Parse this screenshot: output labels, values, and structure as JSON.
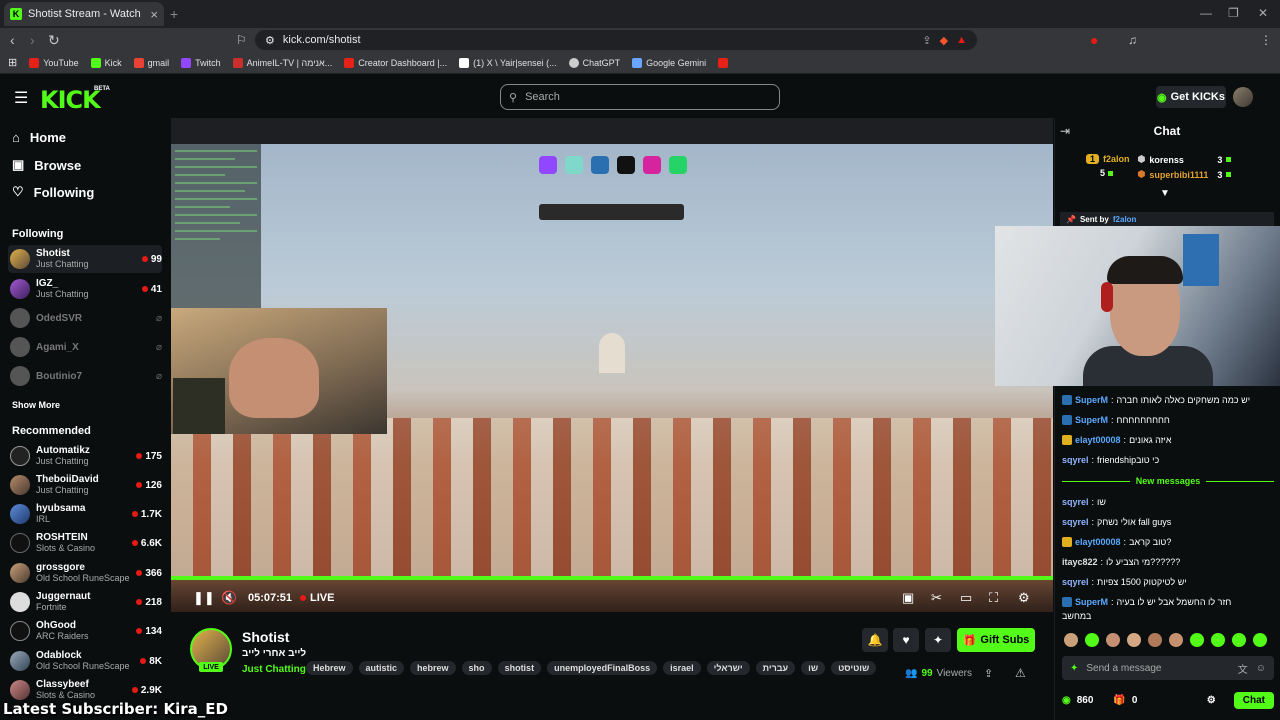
{
  "browser": {
    "tab_title": "Shotist Stream - Watch Live on Ki",
    "url": "kick.com/shotist",
    "bookmarks": [
      {
        "label": "YouTube",
        "color": "#e62117"
      },
      {
        "label": "Kick",
        "color": "#53fc18"
      },
      {
        "label": "gmail",
        "color": "#ea4335"
      },
      {
        "label": "Twitch",
        "color": "#9146ff"
      },
      {
        "label": "AnimeIL-TV | אנימה...",
        "color": "#c9302c"
      },
      {
        "label": "Creator Dashboard |...",
        "color": "#e62117"
      },
      {
        "label": "(1) X \\ Yair|sensei (...",
        "color": "#ffffff"
      },
      {
        "label": "ChatGPT",
        "color": "#cccccc"
      },
      {
        "label": "Google Gemini",
        "color": "#6aa6ff"
      }
    ]
  },
  "header": {
    "logo": "KICK",
    "beta": "BETA",
    "search_placeholder": "Search",
    "get_kicks": "Get KICKs"
  },
  "sidebar": {
    "nav": [
      "Home",
      "Browse",
      "Following"
    ],
    "following_title": "Following",
    "following": [
      {
        "name": "Shotist",
        "category": "Just Chatting",
        "viewers": "99",
        "live": true
      },
      {
        "name": "IGZ_",
        "category": "Just Chatting",
        "viewers": "41",
        "live": true
      },
      {
        "name": "OdedSVR",
        "category": "",
        "viewers": "",
        "live": false
      },
      {
        "name": "Agami_X",
        "category": "",
        "viewers": "",
        "live": false
      },
      {
        "name": "Boutinio7",
        "category": "",
        "viewers": "",
        "live": false
      }
    ],
    "show_more": "Show More",
    "recommended_title": "Recommended",
    "recommended": [
      {
        "name": "Automatikz",
        "category": "Just Chatting",
        "viewers": "175"
      },
      {
        "name": "TheboiiDavid",
        "category": "Just Chatting",
        "viewers": "126"
      },
      {
        "name": "hyubsama",
        "category": "IRL",
        "viewers": "1.7K"
      },
      {
        "name": "ROSHTEIN",
        "category": "Slots & Casino",
        "viewers": "6.6K"
      },
      {
        "name": "grossgore",
        "category": "Old School RuneScape",
        "viewers": "366"
      },
      {
        "name": "Juggernaut",
        "category": "Fortnite",
        "viewers": "218"
      },
      {
        "name": "OhGood",
        "category": "ARC Raiders",
        "viewers": "134"
      },
      {
        "name": "Odablock",
        "category": "Old School RuneScape",
        "viewers": "8K"
      },
      {
        "name": "Classybeef",
        "category": "Slots & Casino",
        "viewers": "2.9K"
      }
    ]
  },
  "player": {
    "time": "05:07:51",
    "live_label": "LIVE",
    "progress_fraction": 1.0
  },
  "channel": {
    "name": "Shotist",
    "title": "לייב אחרי לייב",
    "category": "Just Chatting",
    "live_badge": "LIVE",
    "tags": [
      "Hebrew",
      "autistic",
      "hebrew",
      "sho",
      "shotist",
      "unemployedFinalBoss",
      "israel",
      "ישראלי",
      "עברית",
      "שו",
      "שוטיסט"
    ],
    "gift_subs": "Gift Subs",
    "viewers": "99",
    "viewers_label": "Viewers"
  },
  "chat": {
    "title": "Chat",
    "leaderboard": [
      {
        "name": "f2alon",
        "count": "5",
        "rank": "1"
      },
      {
        "name": "korenss",
        "count": "3"
      },
      {
        "name": "superbibi1111",
        "count": "3"
      }
    ],
    "pinned_label": "Sent by",
    "pinned_user": "f2alon",
    "messages": [
      {
        "user": "SuperM",
        "text": "יש כמה משחקים כאלה לאותו חברה",
        "color": "#5aa9ff"
      },
      {
        "user": "SuperM",
        "text": "חחחחחחחחח",
        "color": "#5aa9ff"
      },
      {
        "user": "elayt00008",
        "text": "איזה גאונים",
        "color": "#5aa9ff"
      },
      {
        "user": "sqyrel",
        "text": "friendshipכי טוב",
        "color": "#8fb4ff"
      }
    ],
    "new_messages": "New messages",
    "messages_new": [
      {
        "user": "sqyrel",
        "text": "שו",
        "color": "#8fb4ff"
      },
      {
        "user": "sqyrel",
        "text": "אולי נשחק fall guys",
        "color": "#8fb4ff"
      },
      {
        "user": "elayt00008",
        "text": "טוב קראב?",
        "color": "#5aa9ff"
      },
      {
        "user": "itayc822",
        "text": "מי הצביע לו??????",
        "color": "#e0e0e0"
      },
      {
        "user": "sqyrel",
        "text": "יש לטיקטוק 1500 צפיות",
        "color": "#8fb4ff"
      },
      {
        "user": "SuperM",
        "text": "חזר לו החשמל אבל יש לו בעיה",
        "color": "#5aa9ff"
      }
    ],
    "wrap_text": "במחשב",
    "input_placeholder": "Send a message",
    "kicks_count": "860",
    "sub_count": "0",
    "chat_button": "Chat"
  },
  "overlay": {
    "latest_subscriber": "Latest Subscriber: Kira_ED"
  }
}
